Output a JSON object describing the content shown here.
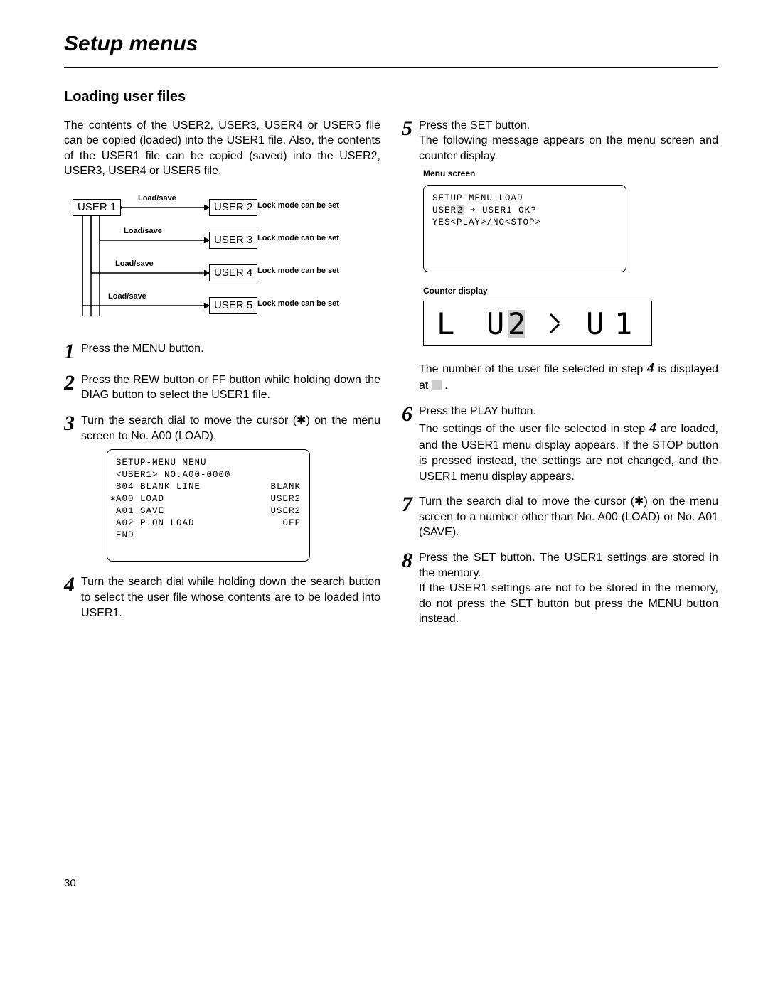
{
  "title": "Setup menus",
  "section": "Loading user files",
  "intro": "The contents of the USER2, USER3, USER4 or USER5 file can be copied (loaded) into the USER1 file. Also, the contents of the USER1 file can be copied (saved) into the USER2, USER3, USER4 or USER5 file.",
  "diagram": {
    "user1": "USER 1",
    "user2": "USER 2",
    "user3": "USER 3",
    "user4": "USER 4",
    "user5": "USER 5",
    "loadsave": "Load/save",
    "lock": "Lock mode can be set"
  },
  "steps": {
    "s1": "Press the MENU button.",
    "s2": "Press the REW button or FF button while holding down the DIAG button to select the USER1 file.",
    "s3": "Turn the search dial to move the cursor (✱) on the menu screen to No. A00 (LOAD).",
    "s4": "Turn the search dial while holding down the search button to select the user file whose contents are to be loaded into USER1.",
    "s5a": "Press the SET button.",
    "s5b": "The following message appears on the menu screen and counter display.",
    "s5note": "The number of the user file selected in step ",
    "s5note2": " is displayed at ",
    "s6a": "Press the PLAY button.",
    "s6b": "The settings of the user file selected in step ",
    "s6c": " are loaded, and the USER1 menu display appears. If the STOP button is pressed instead, the settings are not changed, and the USER1 menu display appears.",
    "s7": "Turn the search dial to move the cursor (✱) on the menu screen to a number other than No. A00 (LOAD) or No. A01 (SAVE).",
    "s8a": "Press the SET button. The USER1 settings are stored in the memory.",
    "s8b": "If the USER1 settings are not to be stored in the memory, do not press the SET button but press the MENU button instead."
  },
  "menubox1": {
    "l1": "SETUP-MENU   MENU",
    "l2": "<USER1>    NO.A00-0000",
    "l3_left": " 804 BLANK LINE",
    "l3_right": "BLANK",
    "l4_left": "A00 LOAD",
    "l4_right": "USER2",
    "l5_left": " A01 SAVE",
    "l5_right": "USER2",
    "l6_left": " A02 P.ON LOAD",
    "l6_right": "OFF",
    "l7": " END"
  },
  "menuscreen_caption": "Menu screen",
  "menubox2": {
    "l1": "SETUP-MENU  LOAD",
    "l2_a": "USER",
    "l2_b": "2",
    "l2_c": " ➔ USER1 OK?",
    "l3": "YES<PLAY>/NO<STOP>"
  },
  "counter_caption": "Counter display",
  "counter": {
    "g1": "L",
    "g2a": "U",
    "g2b": "2",
    "g3": ">",
    "g4": "U1"
  },
  "page": "30"
}
